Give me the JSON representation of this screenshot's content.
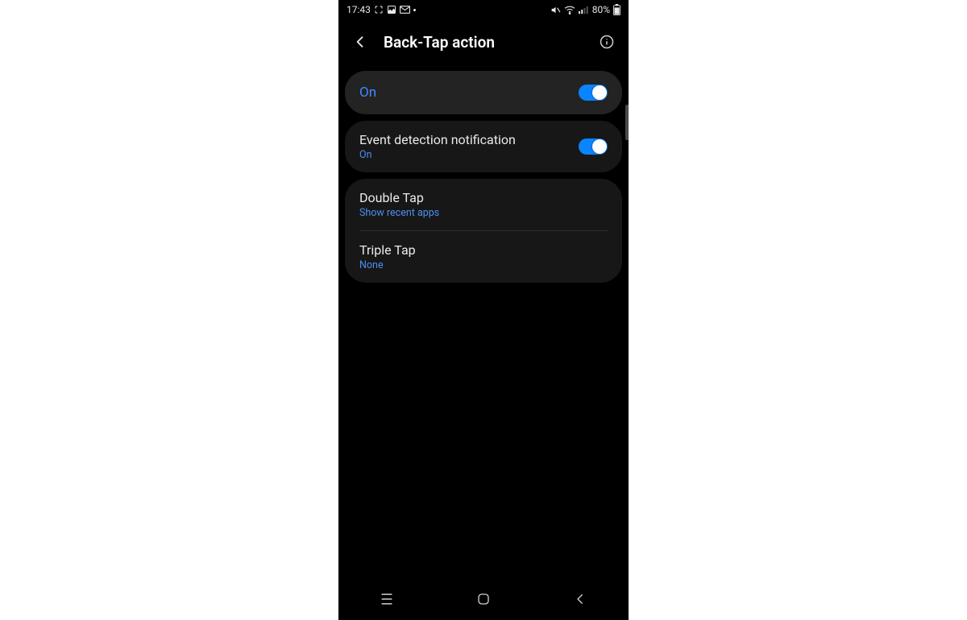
{
  "statusbar": {
    "time": "17:43",
    "battery": "80%"
  },
  "header": {
    "title": "Back-Tap action"
  },
  "master": {
    "label": "On"
  },
  "settings": [
    {
      "title": "Event detection notification",
      "sub": "On",
      "toggle": true
    },
    {
      "title": "Double Tap",
      "sub": "Show recent apps",
      "toggle": false
    },
    {
      "title": "Triple Tap",
      "sub": "None",
      "toggle": false
    }
  ],
  "colors": {
    "accent": "#3d8bff",
    "toggle_track": "#0a84ff",
    "sub_text": "#4b8ef0"
  }
}
